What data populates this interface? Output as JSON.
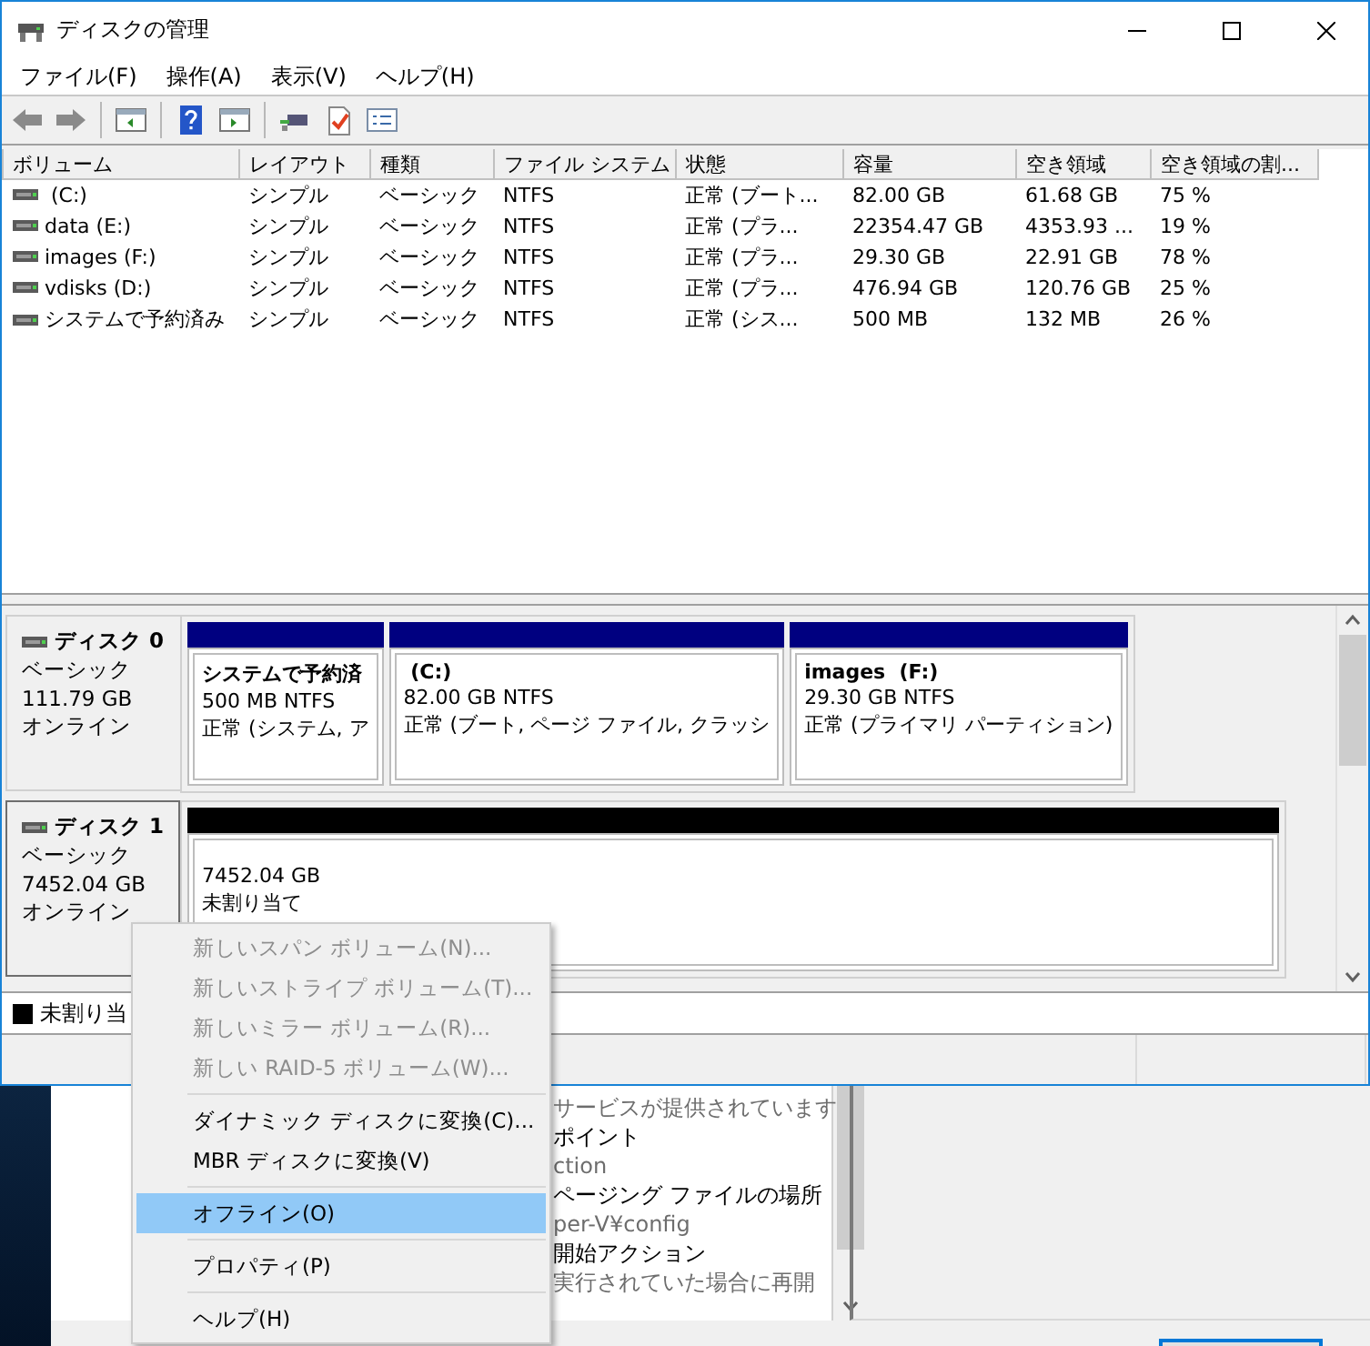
{
  "window": {
    "title": "ディスクの管理"
  },
  "menu": [
    "ファイル(F)",
    "操作(A)",
    "表示(V)",
    "ヘルプ(H)"
  ],
  "volumes": {
    "columns": [
      "ボリューム",
      "レイアウト",
      "種類",
      "ファイル システム",
      "状態",
      "容量",
      "空き領域",
      "空き領域の割..."
    ],
    "rows": [
      [
        " (C:)",
        "シンプル",
        "ベーシック",
        "NTFS",
        "正常 (ブート...",
        "82.00 GB",
        "61.68 GB",
        "75 %"
      ],
      [
        "data (E:)",
        "シンプル",
        "ベーシック",
        "NTFS",
        "正常 (プラ...",
        "22354.47 GB",
        "4353.93 ...",
        "19 %"
      ],
      [
        "images (F:)",
        "シンプル",
        "ベーシック",
        "NTFS",
        "正常 (プラ...",
        "29.30 GB",
        "22.91 GB",
        "78 %"
      ],
      [
        "vdisks (D:)",
        "シンプル",
        "ベーシック",
        "NTFS",
        "正常 (プラ...",
        "476.94 GB",
        "120.76 GB",
        "25 %"
      ],
      [
        "システムで予約済み",
        "シンプル",
        "ベーシック",
        "NTFS",
        "正常 (シス...",
        "500 MB",
        "132 MB",
        "26 %"
      ]
    ]
  },
  "disks": [
    {
      "name": "ディスク 0",
      "type": "ベーシック",
      "size": "111.79 GB",
      "status": "オンライン",
      "selected": false,
      "partitions": [
        {
          "kind": "primary",
          "title": "システムで予約済",
          "size": "500 MB NTFS",
          "status": "正常 (システム, ア"
        },
        {
          "kind": "primary",
          "title": " (C:)",
          "size": "82.00 GB NTFS",
          "status": "正常 (ブート, ページ ファイル, クラッシ"
        },
        {
          "kind": "primary",
          "title": "images  (F:)",
          "size": "29.30 GB NTFS",
          "status": "正常 (プライマリ パーティション)"
        }
      ]
    },
    {
      "name": "ディスク 1",
      "type": "ベーシック",
      "size": "7452.04 GB",
      "status": "オンライン",
      "selected": true,
      "partitions": [
        {
          "kind": "unallocated",
          "size": "7452.04 GB",
          "status": "未割り当て"
        }
      ]
    }
  ],
  "legend": [
    {
      "label": "未割り当",
      "color": "#000000"
    }
  ],
  "context_menu": [
    {
      "kind": "item",
      "label": "新しいスパン ボリューム(N)...",
      "disabled": true,
      "selected": false
    },
    {
      "kind": "item",
      "label": "新しいストライプ ボリューム(T)...",
      "disabled": true,
      "selected": false
    },
    {
      "kind": "item",
      "label": "新しいミラー ボリューム(R)...",
      "disabled": true,
      "selected": false
    },
    {
      "kind": "item",
      "label": "新しい RAID-5 ボリューム(W)...",
      "disabled": true,
      "selected": false
    },
    {
      "kind": "separator"
    },
    {
      "kind": "item",
      "label": "ダイナミック ディスクに変換(C)...",
      "disabled": false,
      "selected": false
    },
    {
      "kind": "item",
      "label": "MBR ディスクに変換(V)",
      "disabled": false,
      "selected": false
    },
    {
      "kind": "separator"
    },
    {
      "kind": "item",
      "label": "オフライン(O)",
      "disabled": false,
      "selected": true
    },
    {
      "kind": "separator"
    },
    {
      "kind": "item",
      "label": "プロパティ(P)",
      "disabled": false,
      "selected": false
    },
    {
      "kind": "separator"
    },
    {
      "kind": "item",
      "label": "ヘルプ(H)",
      "disabled": false,
      "selected": false
    }
  ],
  "background_dialog": {
    "lines": [
      {
        "kind": "detail",
        "text": "サービスが提供されています"
      },
      {
        "kind": "title",
        "text": "ポイント"
      },
      {
        "kind": "detail",
        "text": "ction"
      },
      {
        "kind": "title",
        "text": "ページング ファイルの場所"
      },
      {
        "kind": "detail",
        "text": "per-V¥config"
      },
      {
        "kind": "title",
        "text": "開始アクション"
      },
      {
        "kind": "detail",
        "text": "実行されていた場合に再開"
      }
    ]
  }
}
